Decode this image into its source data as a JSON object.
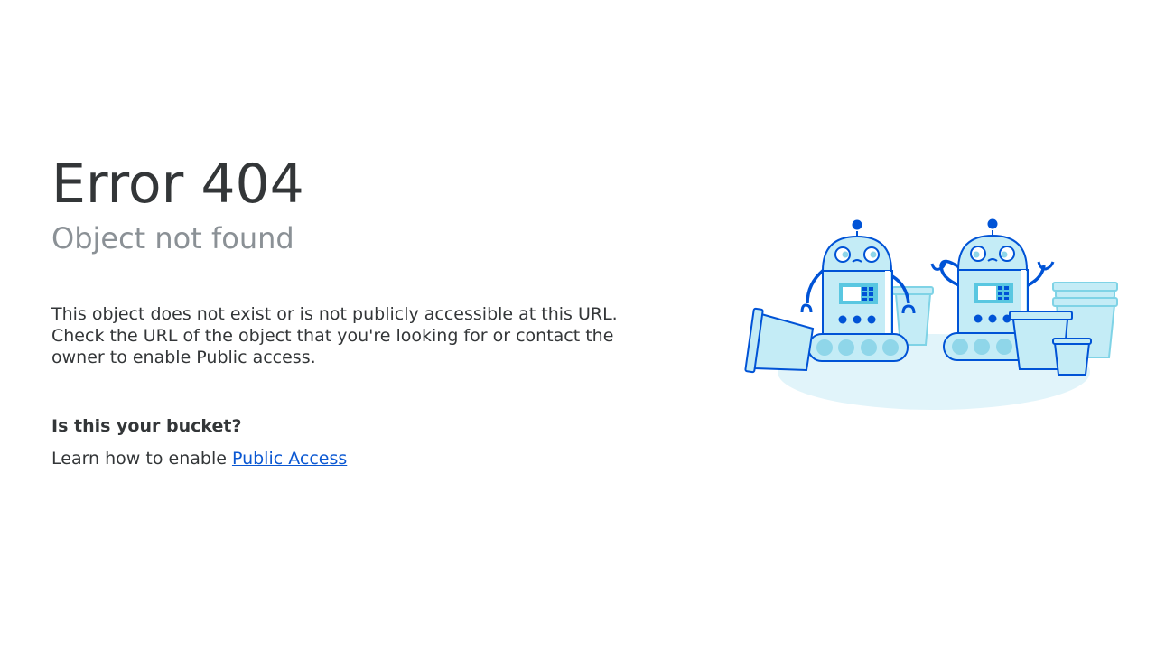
{
  "error": {
    "title": "Error 404",
    "subtitle": "Object not found",
    "description_lines": [
      "This object does not exist or is not publicly accessible at this URL.",
      "Check the URL of the object that you're looking for or contact the",
      "owner to enable Public access."
    ]
  },
  "help": {
    "question": "Is this your bucket?",
    "prefix": "Learn how to enable ",
    "link_label": "Public Access"
  },
  "colors": {
    "title": "#333638",
    "subtitle": "#8b9196",
    "link": "#0a57d2",
    "robot_outline": "#0053d6",
    "robot_fill": "#c4ecf6",
    "robot_light": "#8fd6e9",
    "shadow": "#e1f4fa"
  },
  "illustration": {
    "icon": "robots-with-buckets-illustration"
  }
}
